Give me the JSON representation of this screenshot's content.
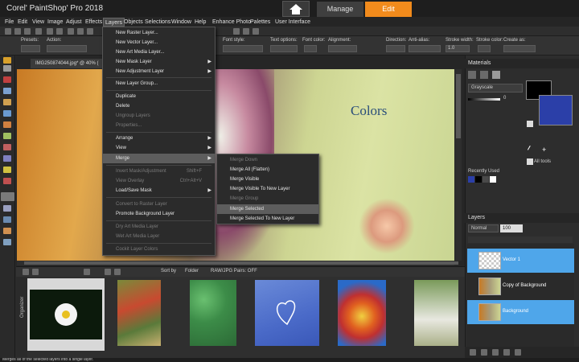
{
  "app": {
    "title": "Corel' PaintShop' Pro 2018",
    "manage_tab": "Manage",
    "edit_tab": "Edit"
  },
  "menubar": [
    "File",
    "Edit",
    "View",
    "Image",
    "Adjust",
    "Effects",
    "Layers",
    "Objects",
    "Selections",
    "Window",
    "Help",
    "Enhance Photo",
    "Palettes",
    "User Interface"
  ],
  "tool_options": {
    "presets": "Presets:",
    "action": "Action:",
    "font_style": "Font style:",
    "text_options": "Text options:",
    "font_color": "Font color:",
    "alignment": "Alignment:",
    "direction": "Direction:",
    "anti_alias": "Anti-alias:",
    "stroke_width": "Stroke width:",
    "stroke_color": "Stroke color:",
    "create_as": "Create as:",
    "stroke_width_value": "1.0"
  },
  "document": {
    "tab_label": "IMG250874044.jpg* @  40% (",
    "overlay_text": "Colors"
  },
  "layers_menu": {
    "items": [
      {
        "label": "New Raster Layer...",
        "state": "enabled"
      },
      {
        "label": "New Vector Layer...",
        "state": "enabled"
      },
      {
        "label": "New Art Media Layer...",
        "state": "enabled"
      },
      {
        "label": "New Mask Layer",
        "state": "enabled",
        "submenu": true
      },
      {
        "label": "New Adjustment Layer",
        "state": "enabled",
        "submenu": true
      },
      {
        "label": "New Layer Group...",
        "state": "enabled"
      },
      {
        "label": "Duplicate",
        "state": "enabled"
      },
      {
        "label": "Delete",
        "state": "enabled"
      },
      {
        "label": "Ungroup Layers",
        "state": "disabled"
      },
      {
        "label": "Properties...",
        "state": "disabled"
      },
      {
        "label": "Arrange",
        "state": "enabled",
        "submenu": true
      },
      {
        "label": "View",
        "state": "enabled",
        "submenu": true
      },
      {
        "label": "Merge",
        "state": "highlighted",
        "submenu": true
      },
      {
        "label": "Invert Mask/Adjustment",
        "state": "disabled",
        "shortcut": "Shift+F"
      },
      {
        "label": "View Overlay",
        "state": "disabled",
        "shortcut": "Ctrl+Alt+V"
      },
      {
        "label": "Load/Save Mask",
        "state": "enabled",
        "submenu": true
      },
      {
        "label": "Convert to Raster Layer",
        "state": "disabled"
      },
      {
        "label": "Promote Background Layer",
        "state": "enabled"
      },
      {
        "label": "Dry Art Media Layer",
        "state": "disabled"
      },
      {
        "label": "Wet Art Media Layer",
        "state": "disabled"
      },
      {
        "label": "Cockit Layer Colors",
        "state": "disabled"
      }
    ]
  },
  "merge_menu": {
    "items": [
      {
        "label": "Merge Down",
        "state": "disabled"
      },
      {
        "label": "Merge All (Flatten)",
        "state": "enabled"
      },
      {
        "label": "Merge Visible",
        "state": "enabled"
      },
      {
        "label": "Merge Visible To New Layer",
        "state": "enabled"
      },
      {
        "label": "Merge Group",
        "state": "disabled"
      },
      {
        "label": "Merge Selected",
        "state": "highlighted"
      },
      {
        "label": "Merge Selected To New Layer",
        "state": "enabled"
      }
    ]
  },
  "organizer": {
    "label": "Organizer",
    "sort_by": "Sort by",
    "sort_value": "Folder",
    "raw_pairs": "RAW/JPG Pairs: OFF"
  },
  "materials": {
    "title": "Materials",
    "mode": "Grayscale",
    "slider_value": "0",
    "recently_used": "Recently Used",
    "all_tools": "All tools"
  },
  "layers_panel": {
    "title": "Layers",
    "blend_mode": "Normal",
    "opacity": "100",
    "layers": [
      {
        "name": "Vector 1"
      },
      {
        "name": "Copy of Background"
      },
      {
        "name": "Background"
      }
    ]
  },
  "statusbar": {
    "text": "Merges all of the selected layers into a single layer."
  },
  "colors": {
    "accent": "#f28b1c",
    "selection": "#4fa6ea",
    "menu_bg": "#2b2b2b"
  }
}
